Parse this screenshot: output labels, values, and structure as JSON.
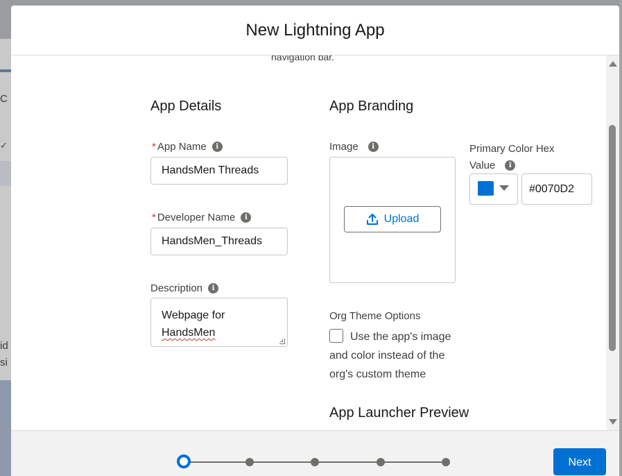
{
  "background": {
    "left_text_1": "id",
    "left_text_2": "si",
    "left_text_3": "C"
  },
  "modal": {
    "title": "New Lightning App",
    "clipped_text": "navigation bar."
  },
  "app_details": {
    "title": "App Details",
    "app_name": {
      "label": "App Name",
      "required_mark": "*",
      "value": "HandsMen Threads"
    },
    "developer_name": {
      "label": "Developer Name",
      "required_mark": "*",
      "value": "HandsMen_Threads"
    },
    "description": {
      "label": "Description",
      "value_line1": "Webpage for",
      "value_line2": "HandsMen"
    }
  },
  "app_branding": {
    "title": "App Branding",
    "image_label": "Image",
    "upload_label": "Upload",
    "primary_color_label_line1": "Primary Color Hex",
    "primary_color_label_line2": "Value",
    "primary_color_hex": "#0070D2",
    "swatch_color": "#0070d2"
  },
  "org_theme": {
    "label": "Org Theme Options",
    "checkbox_label": "Use the app's image and color instead of the org's custom theme",
    "checked": false
  },
  "preview": {
    "title": "App Launcher Preview"
  },
  "footer": {
    "next_label": "Next",
    "steps_total": 5,
    "current_step": 1
  },
  "icons": {
    "info": "i",
    "upload": "upload-icon"
  }
}
